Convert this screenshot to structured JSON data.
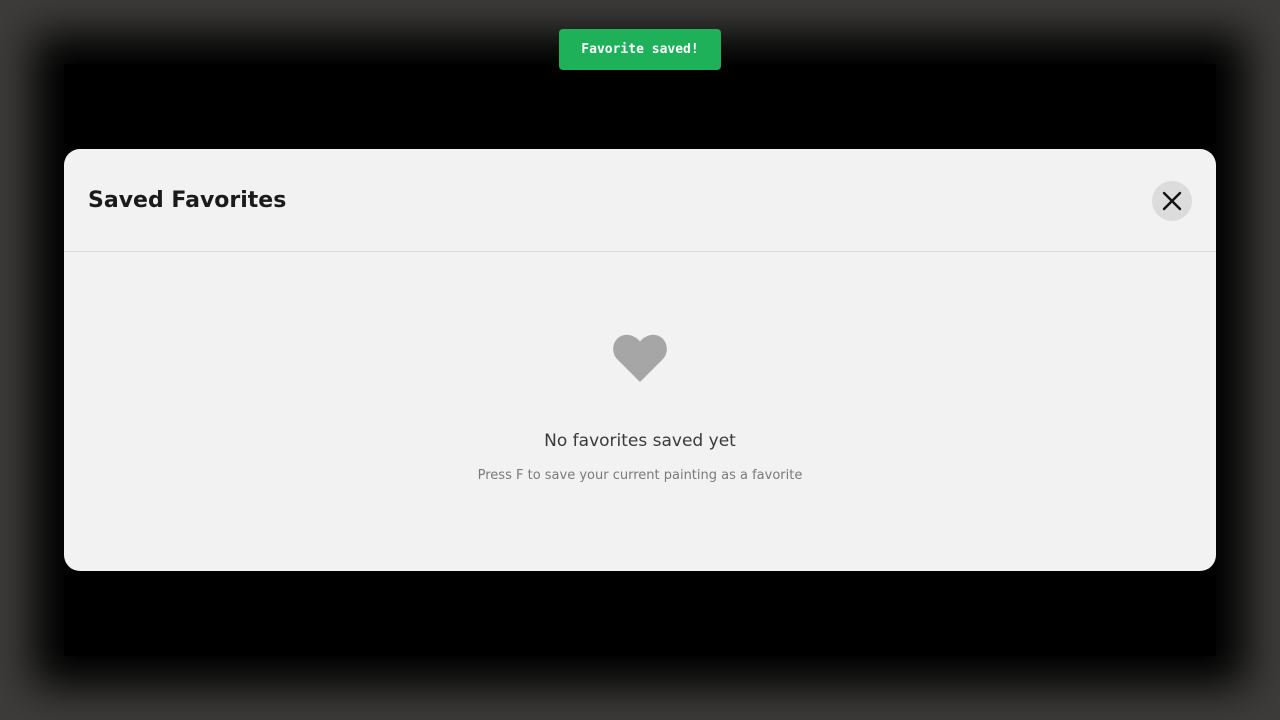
{
  "toast": {
    "message": "Favorite saved!",
    "color": "#1fb15a"
  },
  "modal": {
    "title": "Saved Favorites",
    "close_icon": "close-icon",
    "empty_state": {
      "icon": "heart-icon",
      "title": "No favorites saved yet",
      "hint": "Press F to save your current painting as a favorite"
    }
  },
  "colors": {
    "backdrop": "#3d3c3a",
    "modal_background": "#f2f2f2",
    "heart": "#a6a6a6"
  }
}
